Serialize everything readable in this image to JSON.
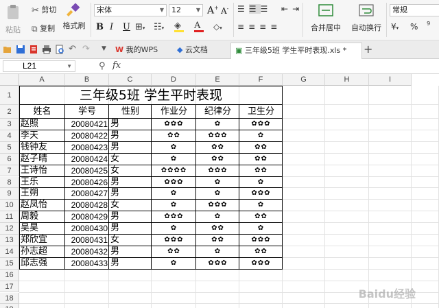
{
  "ribbon": {
    "paste_label": "粘贴",
    "cut_label": "剪切",
    "copy_label": "复制",
    "format_painter_label": "格式刷",
    "font_name": "宋体",
    "font_size": "12",
    "bold": "B",
    "italic": "I",
    "underline": "U",
    "merge_center_label": "合并居中",
    "wrap_text_label": "自动换行",
    "number_format": "常规",
    "percent": "%",
    "comma": "⁹"
  },
  "tabs": {
    "wps_tab": "我的WPS",
    "cloud_tab": "云文档",
    "file_tab": "三年级5班 学生平时表现.xls *",
    "add_tab": "+"
  },
  "formula_bar": {
    "name_box": "L21",
    "fx": "fx",
    "value": ""
  },
  "sheet": {
    "columns": [
      "A",
      "B",
      "C",
      "D",
      "E",
      "F",
      "G",
      "H",
      "I"
    ],
    "rows": [
      "1",
      "2",
      "3",
      "4",
      "5",
      "6",
      "7",
      "8",
      "9",
      "10",
      "11",
      "12",
      "13",
      "14",
      "15",
      "16",
      "17",
      "18",
      "19"
    ],
    "title": "三年级5班  学生平时表现",
    "headers": [
      "姓名",
      "学号",
      "性别",
      "作业分",
      "纪律分",
      "卫生分"
    ],
    "records": [
      {
        "name": "赵照",
        "id": "20080421",
        "gender": "男",
        "homework": "✿✿✿",
        "discipline": "✿",
        "hygiene": "✿✿✿"
      },
      {
        "name": "李天",
        "id": "20080422",
        "gender": "男",
        "homework": "✿✿",
        "discipline": "✿✿✿",
        "hygiene": "✿"
      },
      {
        "name": "钱钟友",
        "id": "20080423",
        "gender": "男",
        "homework": "✿",
        "discipline": "✿✿",
        "hygiene": "✿✿"
      },
      {
        "name": "赵子晴",
        "id": "20080424",
        "gender": "女",
        "homework": "✿",
        "discipline": "✿✿",
        "hygiene": "✿✿"
      },
      {
        "name": "王诗怡",
        "id": "20080425",
        "gender": "女",
        "homework": "✿✿✿✿",
        "discipline": "✿✿✿",
        "hygiene": "✿✿"
      },
      {
        "name": "王乐",
        "id": "20080426",
        "gender": "男",
        "homework": "✿✿✿",
        "discipline": "✿",
        "hygiene": "✿"
      },
      {
        "name": "王朔",
        "id": "20080427",
        "gender": "男",
        "homework": "✿",
        "discipline": "✿",
        "hygiene": "✿✿✿"
      },
      {
        "name": "赵凤怡",
        "id": "20080428",
        "gender": "女",
        "homework": "✿",
        "discipline": "✿✿✿",
        "hygiene": "✿"
      },
      {
        "name": "周毅",
        "id": "20080429",
        "gender": "男",
        "homework": "✿✿✿",
        "discipline": "✿",
        "hygiene": "✿✿"
      },
      {
        "name": "吴昊",
        "id": "20080430",
        "gender": "男",
        "homework": "✿",
        "discipline": "✿✿",
        "hygiene": "✿"
      },
      {
        "name": "郑欣宜",
        "id": "20080431",
        "gender": "女",
        "homework": "✿✿✿",
        "discipline": "✿✿",
        "hygiene": "✿✿✿"
      },
      {
        "name": "孙志超",
        "id": "20080432",
        "gender": "男",
        "homework": "✿✿",
        "discipline": "✿",
        "hygiene": "✿✿"
      },
      {
        "name": "邱志强",
        "id": "20080433",
        "gender": "男",
        "homework": "✿",
        "discipline": "✿✿✿",
        "hygiene": "✿✿✿"
      }
    ]
  },
  "watermark": "Baidu经验",
  "colors": {
    "wps_red": "#d9342b",
    "cloud_blue": "#2f6fd6",
    "file_green": "#2e8b3a"
  }
}
